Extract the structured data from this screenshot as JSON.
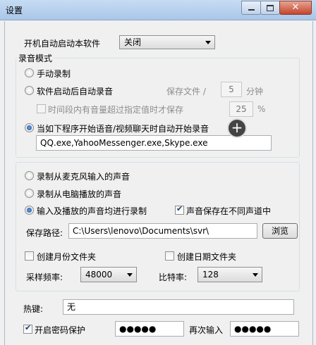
{
  "window": {
    "title": "设置"
  },
  "autostart": {
    "label": "开机自动启动本软件",
    "value": "关闭"
  },
  "record_mode": {
    "legend": "录音模式",
    "manual": "手动录制",
    "auto_on_start": "软件启动后自动录音",
    "save_file_label": "保存文件 /",
    "save_file_value": "5",
    "minutes_unit": "分钟",
    "threshold_label": "时间段内有音量超过指定值时才保存",
    "threshold_value": "25",
    "percent_unit": "%",
    "auto_on_programs": "当如下程序开始语音/视频聊天时自动开始录音",
    "programs_value": "QQ.exe,YahooMessenger.exe,Skype.exe"
  },
  "source": {
    "mic": "录制从麦克风输入的声音",
    "speaker": "录制从电脑播放的声音",
    "both": "输入及播放的声音均进行录制",
    "separate_channels": "声音保存在不同声道中"
  },
  "save_path": {
    "label": "保存路径:",
    "value": "C:\\Users\\lenovo\\Documents\\svr\\",
    "browse": "浏览"
  },
  "folders": {
    "monthly": "创建月份文件夹",
    "daily": "创建日期文件夹"
  },
  "sample_rate": {
    "label": "采样频率:",
    "value": "48000"
  },
  "bit_rate": {
    "label": "比特率:",
    "value": "128"
  },
  "hotkey": {
    "label": "热键:",
    "value": "无"
  },
  "password": {
    "label": "开启密码保护",
    "value": "●●●●●",
    "confirm_label": "再次输入",
    "confirm_value": "●●●●●"
  }
}
